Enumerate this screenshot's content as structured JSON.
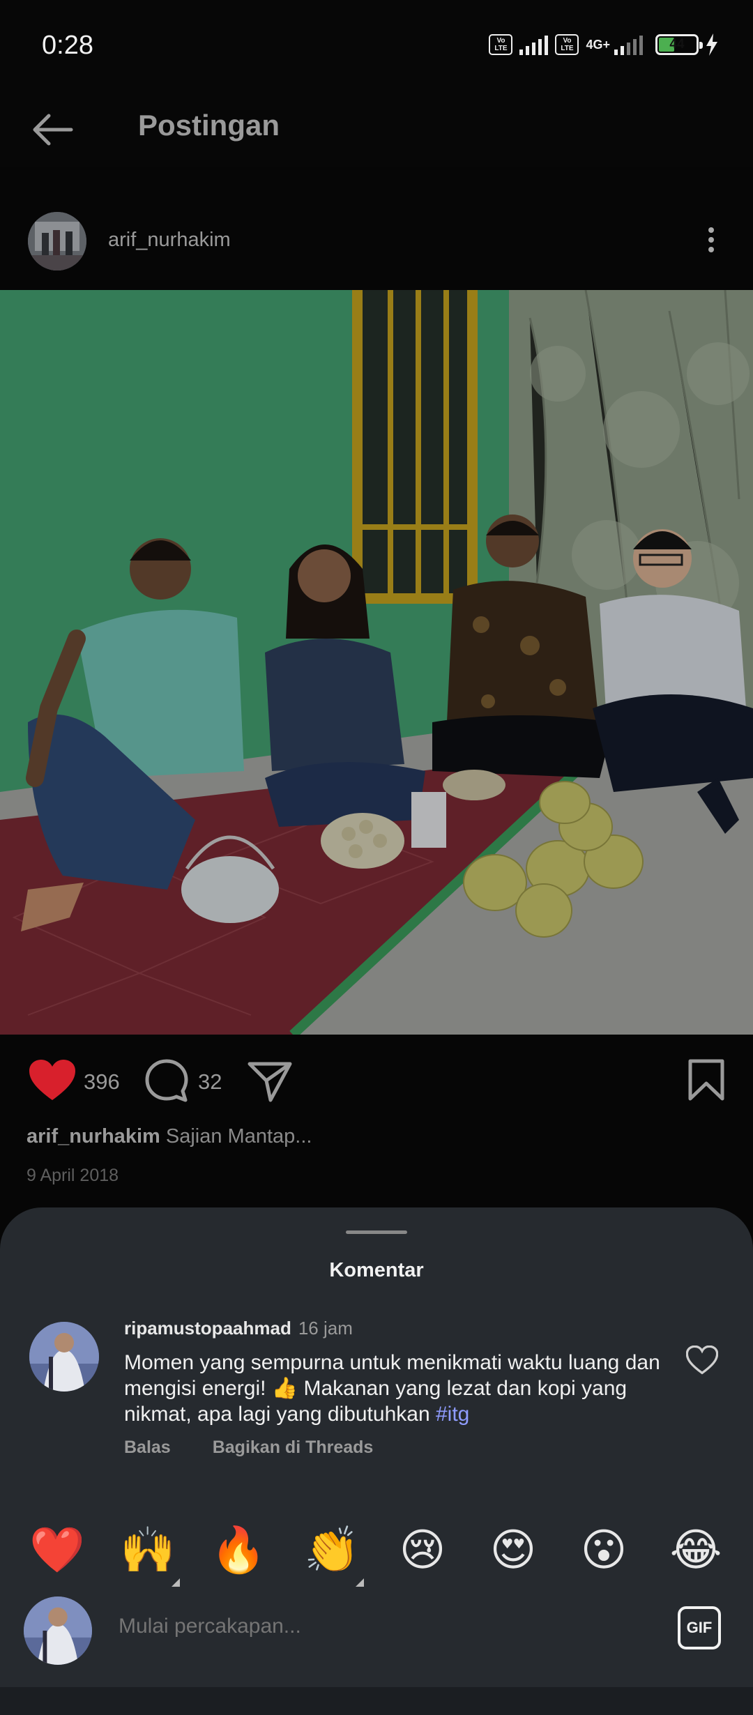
{
  "status_bar": {
    "time": "0:28",
    "volte_1": "Vo LTE",
    "volte_2": "Vo LTE",
    "network": "4G+",
    "battery": "44"
  },
  "header": {
    "back_icon": "arrow-left-icon",
    "title": "Postingan"
  },
  "post": {
    "username": "arif_nurhakim",
    "more_icon": "more-vertical-icon",
    "likes": "396",
    "comments": "32",
    "caption_user": "arif_nurhakim",
    "caption_text": "Sajian Mantap...",
    "date": "9 April 2018",
    "liked_color": "#d8202c"
  },
  "comments_sheet": {
    "title": "Komentar",
    "comment": {
      "username": "ripamustopaahmad",
      "time": "16 jam",
      "text": "Momen yang sempurna untuk menikmati waktu luang dan mengisi energi! 👍 Makanan yang lezat dan kopi yang nikmat, apa lagi yang dibutuhkan",
      "hashtag": "#itg",
      "reply": "Balas",
      "share": "Bagikan di Threads"
    },
    "quick_emojis": [
      "❤️",
      "🙌",
      "🔥",
      "👏",
      "😢",
      "😍",
      "😮",
      "😂"
    ],
    "composer_placeholder": "Mulai percakapan...",
    "gif_label": "GIF"
  }
}
